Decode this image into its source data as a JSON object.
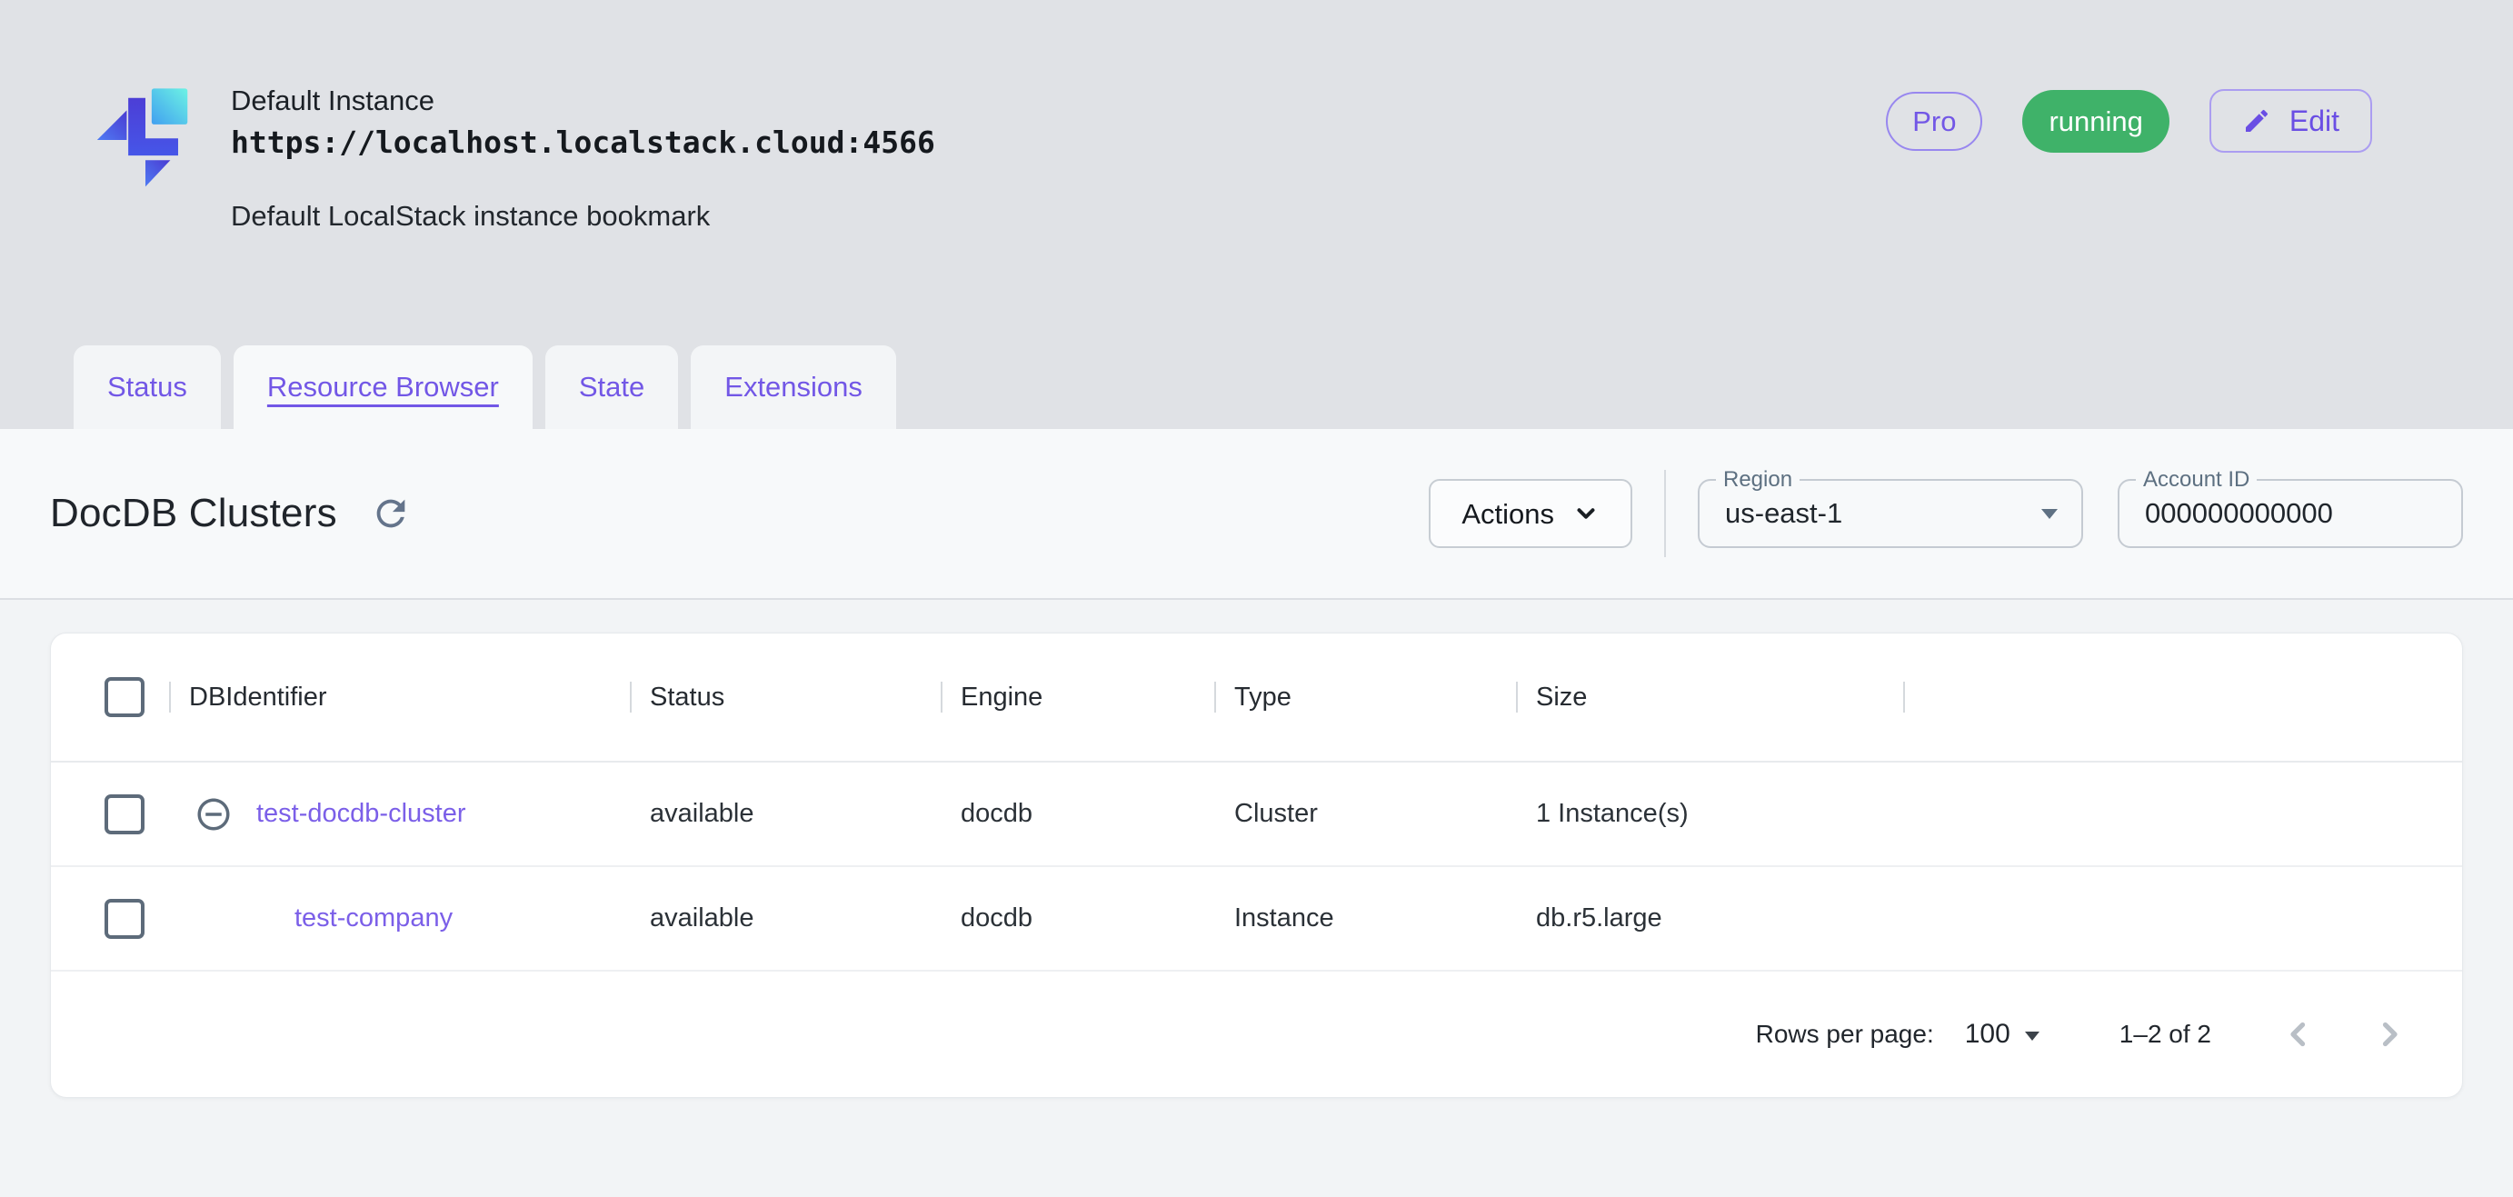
{
  "header": {
    "instance_name": "Default Instance",
    "instance_url": "https://localhost.localstack.cloud:4566",
    "description": "Default LocalStack instance bookmark",
    "pro_badge": "Pro",
    "status_badge": "running",
    "edit_label": "Edit"
  },
  "tabs": [
    {
      "label": "Status",
      "active": false
    },
    {
      "label": "Resource Browser",
      "active": true
    },
    {
      "label": "State",
      "active": false
    },
    {
      "label": "Extensions",
      "active": false
    }
  ],
  "toolbar": {
    "page_title": "DocDB Clusters",
    "actions_label": "Actions",
    "region_label": "Region",
    "region_value": "us-east-1",
    "account_label": "Account ID",
    "account_value": "000000000000"
  },
  "table": {
    "columns": [
      "DBIdentifier",
      "Status",
      "Engine",
      "Type",
      "Size"
    ],
    "rows": [
      {
        "db_identifier": "test-docdb-cluster",
        "status": "available",
        "engine": "docdb",
        "type": "Cluster",
        "size": "1 Instance(s)",
        "expandable": true
      },
      {
        "db_identifier": "test-company",
        "status": "available",
        "engine": "docdb",
        "type": "Instance",
        "size": "db.r5.large",
        "expandable": false
      }
    ]
  },
  "pagination": {
    "rows_per_page_label": "Rows per page:",
    "rows_per_page_value": "100",
    "range": "1–2 of 2"
  },
  "colors": {
    "accent": "#7257e6",
    "running_green": "#3fb269",
    "slate_icon": "#5d6b7a"
  },
  "icons": {
    "logo": "localstack-logo",
    "refresh": "refresh-icon",
    "edit": "pencil-icon",
    "actions_menu": "chevron-down-icon",
    "selects": "dropdown-arrow-icon",
    "row_collapse": "minus-circle-icon",
    "page_prev": "chevron-left-icon",
    "page_next": "chevron-right-icon"
  }
}
